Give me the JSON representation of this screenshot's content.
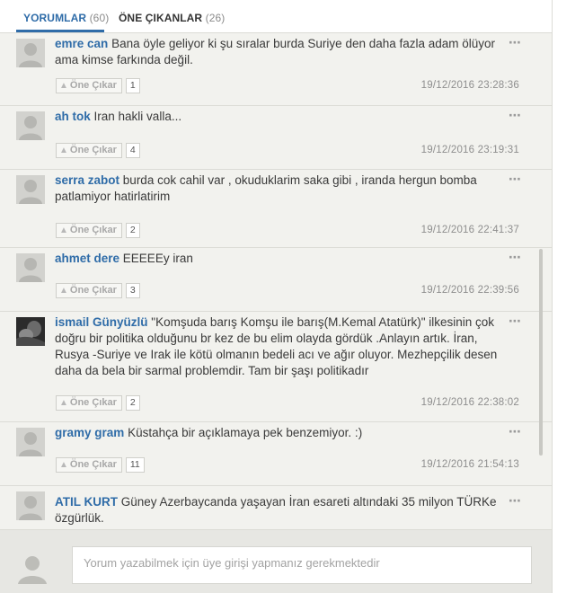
{
  "tabs": [
    {
      "label": "YORUMLAR",
      "count": "(60)",
      "active": true
    },
    {
      "label": "ÖNE ÇIKANLAR",
      "count": "(26)",
      "active": false
    }
  ],
  "feature_label": "Öne Çıkar",
  "more_icon": "⋯",
  "comments": [
    {
      "author": "emre can",
      "text": "Bana öyle geliyor ki şu sıralar burda Suriye den daha fazla adam ölüyor ama kimse farkında değil.",
      "count": "1",
      "date": "19/12/2016 23:28:36",
      "avatar": "default"
    },
    {
      "author": "ah tok",
      "text": "Iran hakli valla...",
      "count": "4",
      "date": "19/12/2016 23:19:31",
      "avatar": "default"
    },
    {
      "author": "serra zabot",
      "text": "burda cok cahil var , okuduklarim saka gibi , iranda hergun bomba patlamiyor hatirlatirim",
      "count": "2",
      "date": "19/12/2016 22:41:37",
      "avatar": "default"
    },
    {
      "author": "ahmet dere",
      "text": "EEEEEy iran",
      "count": "3",
      "date": "19/12/2016 22:39:56",
      "avatar": "default"
    },
    {
      "author": "ismail Günyüzlü",
      "text": "\"Komşuda barış Komşu ile barış(M.Kemal Atatürk)\" ilkesinin çok doğru bir politika olduğunu br kez de bu elim olayda gördük .Anlayın artık. İran, Rusya -Suriye ve Irak ile kötü olmanın bedeli acı ve ağır oluyor. Mezhepçilik desen daha da bela bir sarmal problemdir. Tam bir şaşı politikadır",
      "count": "2",
      "date": "19/12/2016 22:38:02",
      "avatar": "photo"
    },
    {
      "author": "gramy gram",
      "text": "Küstahça bir açıklamaya pek benzemiyor. :)",
      "count": "11",
      "date": "19/12/2016 21:54:13",
      "avatar": "default"
    },
    {
      "author": "ATIL KURT",
      "text": "Güney Azerbaycanda yaşayan İran esareti altındaki 35 milyon TÜRKe özgürlük.",
      "count": "",
      "date": "",
      "avatar": "default"
    }
  ],
  "composer": {
    "placeholder": "Yorum yazabilmek için üye girişi yapmanız gerekmektedir"
  },
  "colors": {
    "accent": "#2f6ca8",
    "background": "#f2f2ee",
    "divider": "#dcdcd6"
  }
}
